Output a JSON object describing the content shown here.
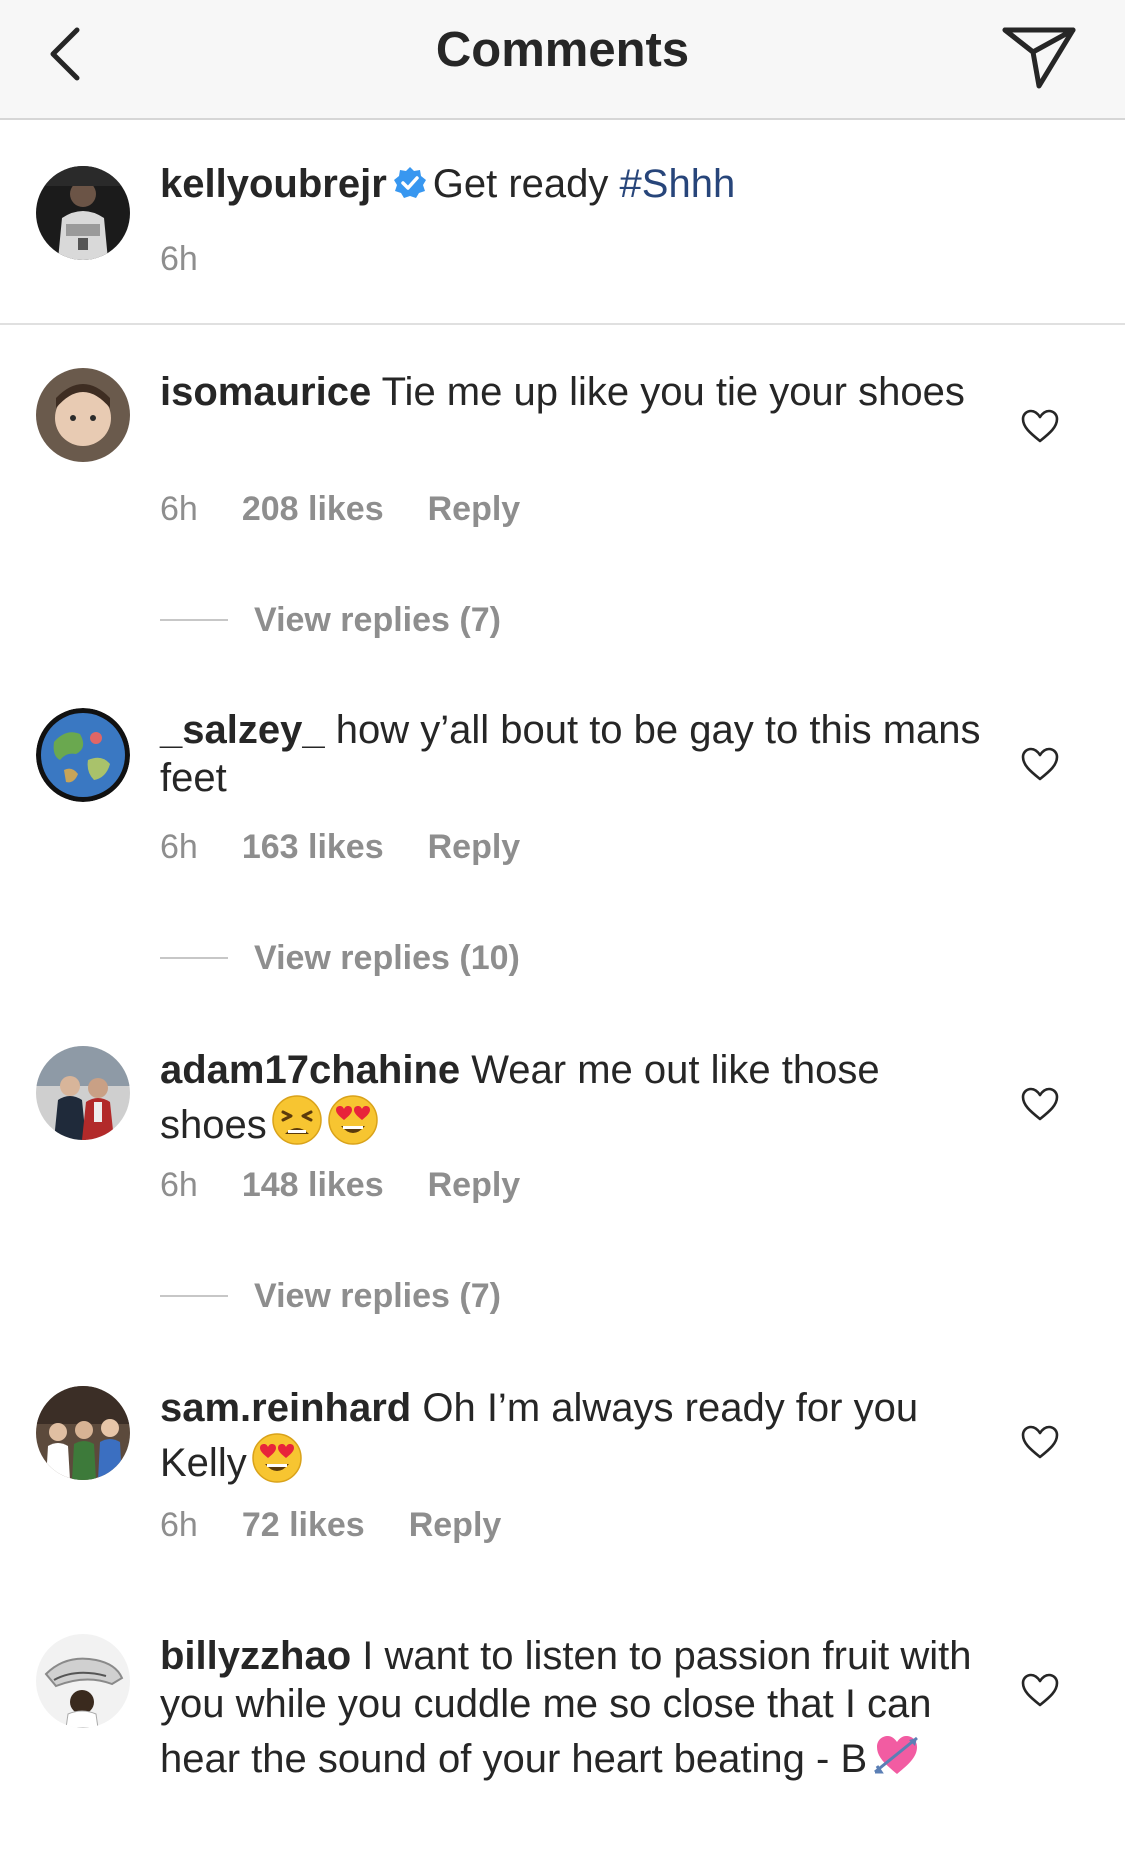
{
  "header": {
    "title": "Comments",
    "back_icon": "chevron-left-icon",
    "direct_icon": "paper-plane-icon"
  },
  "caption": {
    "username": "kellyoubrejr",
    "text": "Get ready ",
    "hashtag": "#Shhh",
    "time": "6h"
  },
  "comments": [
    {
      "username": "isomaurice",
      "text": "Tie me up like you tie your shoes",
      "time": "6h",
      "likes": "208 likes",
      "reply": "Reply",
      "view_replies": "View replies (7)"
    },
    {
      "username": "_salzey_",
      "text": "how y’all bout to be gay to this mans feet",
      "time": "6h",
      "likes": "163 likes",
      "reply": "Reply",
      "view_replies": "View replies (10)"
    },
    {
      "username": "adam17chahine",
      "text": "Wear me out like those shoes",
      "time": "6h",
      "likes": "148 likes",
      "reply": "Reply",
      "view_replies": "View replies (7)"
    },
    {
      "username": "sam.reinhard",
      "text": "Oh I’m always ready for you Kelly",
      "time": "6h",
      "likes": "72 likes",
      "reply": "Reply"
    },
    {
      "username": "billyzzhao",
      "text": "I want to listen to passion fruit with you while you cuddle me so close that I can hear the sound of your heart beating - B"
    }
  ],
  "colors": {
    "text": "#262626",
    "muted": "#8e8e8e",
    "hashtag": "#27457a",
    "verified": "#3897f0",
    "header_bg": "#f7f7f7"
  }
}
